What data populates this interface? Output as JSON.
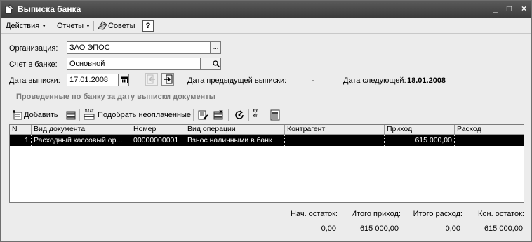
{
  "window": {
    "title": "Выписка банка",
    "controls": {
      "minimize": "_",
      "maximize": "□",
      "close": "×"
    }
  },
  "menu": {
    "actions": "Действия",
    "reports": "Отчеты",
    "tips": "Советы",
    "help": "?"
  },
  "form": {
    "organization_label": "Организация:",
    "organization_value": "ЗАО ЭПОС",
    "bank_account_label": "Счет в банке:",
    "bank_account_value": "Основной",
    "statement_date_label": "Дата выписки:",
    "statement_date_value": "17.01.2008",
    "prev_statement_label": "Дата предыдущей выписки:",
    "prev_statement_value": "-",
    "next_label": "Дата следующей:",
    "next_value": "18.01.2008",
    "ellipsis": "...",
    "search": "⌕"
  },
  "section": {
    "caption": "Проведенные по банку за дату выписки документы"
  },
  "table_toolbar": {
    "add_label": "Добавить",
    "pick_unpaid_label": "Подобрать неоплаченные",
    "pick_icon_text": "ПЛАТ",
    "dt_icon_text": "Дт\nКт"
  },
  "table": {
    "columns": [
      "N",
      "Вид документа",
      "Номер",
      "Вид операции",
      "Контрагент",
      "Приход",
      "Расход"
    ],
    "rows": [
      {
        "n": "1",
        "doc_type": "Расходный кассовый ор...",
        "number": "00000000001",
        "operation": "Взнос наличными в банк",
        "counterparty": "",
        "income": "615 000,00",
        "expense": ""
      }
    ]
  },
  "totals": {
    "start_balance_label": "Нач. остаток:",
    "start_balance_value": "0,00",
    "total_income_label": "Итого приход:",
    "total_income_value": "615 000,00",
    "total_expense_label": "Итого расход:",
    "total_expense_value": "0,00",
    "end_balance_label": "Кон. остаток:",
    "end_balance_value": "615 000,00"
  }
}
